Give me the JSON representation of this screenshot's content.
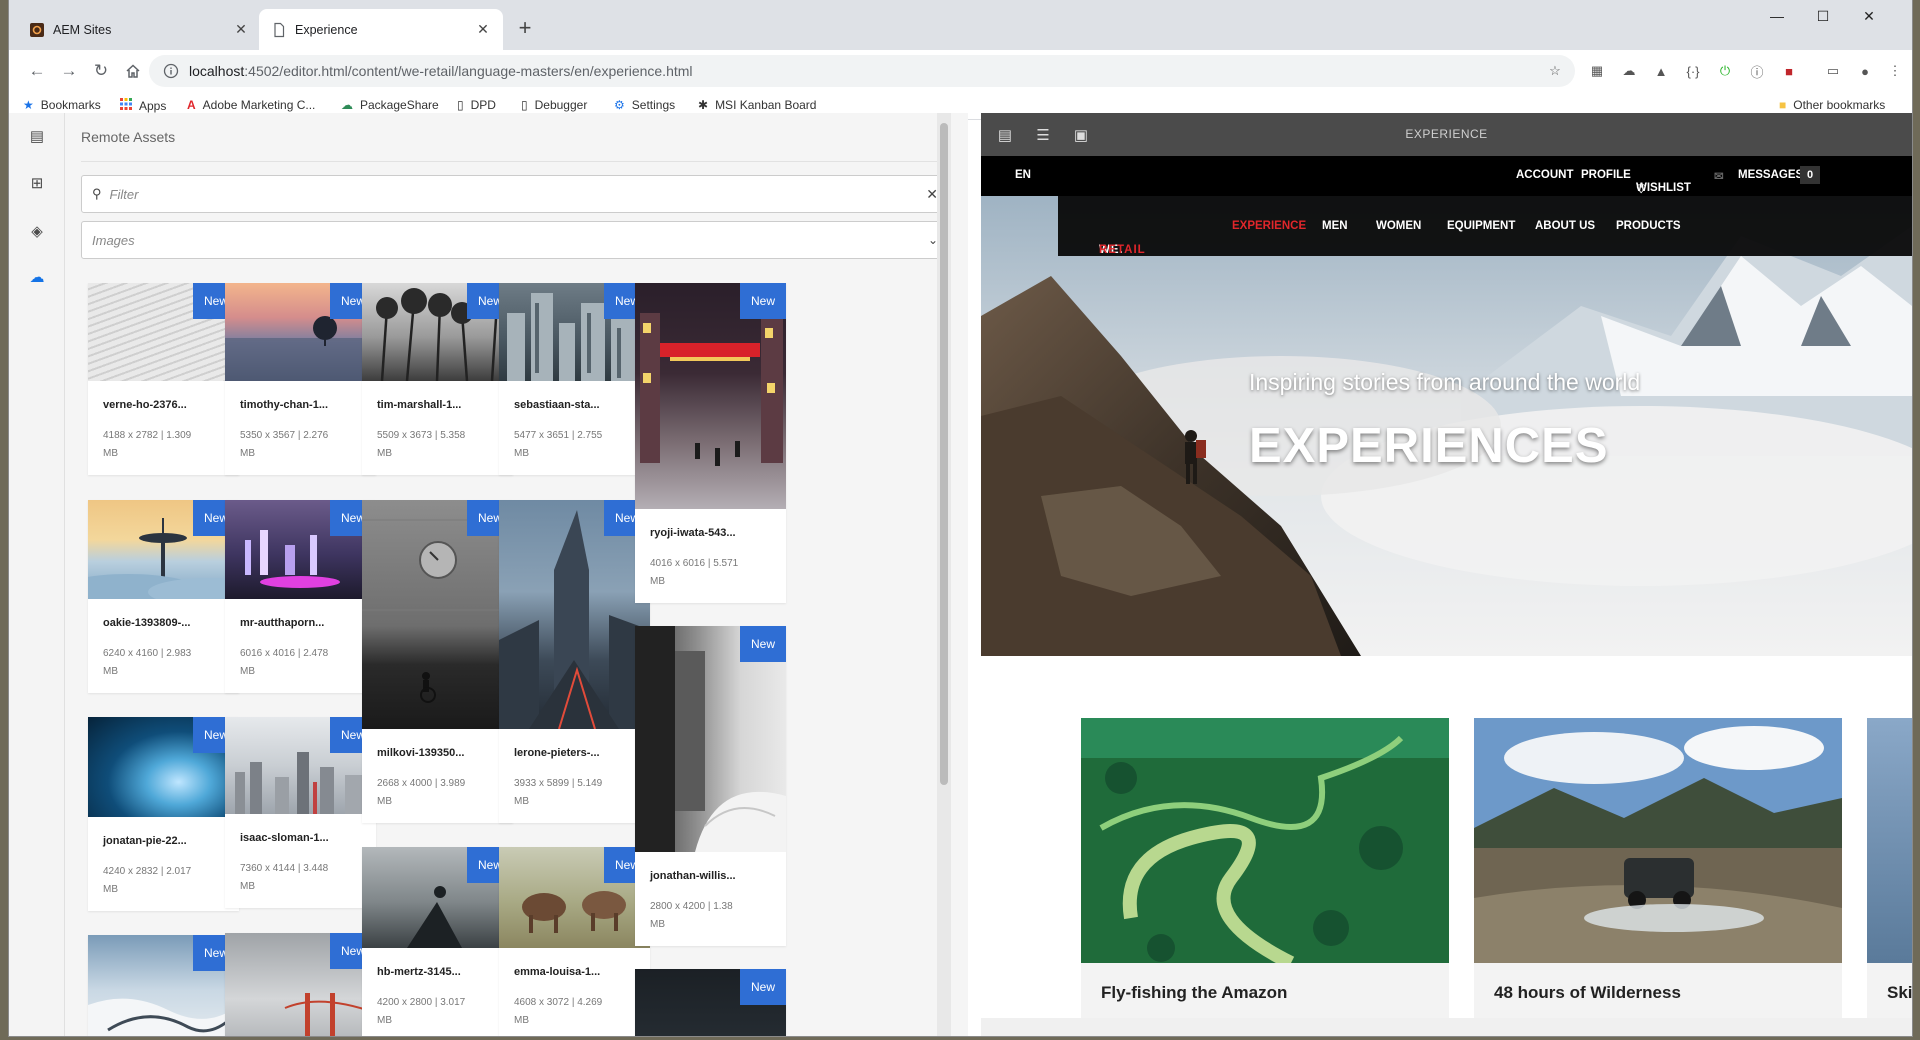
{
  "browser": {
    "tabs": [
      {
        "title": "AEM Sites",
        "close": "✕"
      },
      {
        "title": "Experience",
        "close": "✕"
      }
    ],
    "new_tab": "+",
    "window_controls": {
      "minimize": "—",
      "maximize": "☐",
      "close": "✕"
    },
    "url_host": "localhost",
    "url_path": ":4502/editor.html/content/we-retail/language-masters/en/experience.html",
    "bookmarks": [
      {
        "label": "Bookmarks",
        "icon": "star-icon"
      },
      {
        "label": "Apps",
        "icon": "apps-grid-icon"
      },
      {
        "label": "Adobe Marketing C...",
        "icon": "adobe-icon"
      },
      {
        "label": "PackageShare",
        "icon": "cloud-icon"
      },
      {
        "label": "DPD",
        "icon": "page-icon"
      },
      {
        "label": "Debugger",
        "icon": "page-icon"
      },
      {
        "label": "Settings",
        "icon": "gear-icon"
      },
      {
        "label": "MSI Kanban Board",
        "icon": "kanban-icon"
      }
    ],
    "other_bookmarks": "Other bookmarks"
  },
  "panel": {
    "title": "Remote Assets",
    "filter_placeholder": "Filter",
    "clear": "✕",
    "type_select": "Images"
  },
  "assets": [
    {
      "name": "verne-ho-2376...",
      "dims": "4188 x 2782 | 1.309",
      "unit": "MB",
      "badge": "New"
    },
    {
      "name": "timothy-chan-1...",
      "dims": "5350 x 3567 | 2.276",
      "unit": "MB",
      "badge": "New"
    },
    {
      "name": "tim-marshall-1...",
      "dims": "5509 x 3673 | 5.358",
      "unit": "MB",
      "badge": "New"
    },
    {
      "name": "sebastiaan-sta...",
      "dims": "5477 x 3651 | 2.755",
      "unit": "MB",
      "badge": "New"
    },
    {
      "name": "ryoji-iwata-543...",
      "dims": "4016 x 6016 | 5.571",
      "unit": "MB",
      "badge": "New"
    },
    {
      "name": "oakie-1393809-...",
      "dims": "6240 x 4160 | 2.983",
      "unit": "MB",
      "badge": "New"
    },
    {
      "name": "mr-autthaporn...",
      "dims": "6016 x 4016 | 2.478",
      "unit": "MB",
      "badge": "New"
    },
    {
      "name": "milkovi-139350...",
      "dims": "2668 x 4000 | 3.989",
      "unit": "MB",
      "badge": "New"
    },
    {
      "name": "lerone-pieters-...",
      "dims": "3933 x 5899 | 5.149",
      "unit": "MB",
      "badge": "New"
    },
    {
      "name": "jonathan-willis...",
      "dims": "2800 x 4200 | 1.38",
      "unit": "MB",
      "badge": "New"
    },
    {
      "name": "jonatan-pie-22...",
      "dims": "4240 x 2832 | 2.017",
      "unit": "MB",
      "badge": "New"
    },
    {
      "name": "isaac-sloman-1...",
      "dims": "7360 x 4144 | 3.448",
      "unit": "MB",
      "badge": "New"
    },
    {
      "name": "hb-mertz-3145...",
      "dims": "4200 x 2800 | 3.017",
      "unit": "MB",
      "badge": "New"
    },
    {
      "name": "emma-louisa-1...",
      "dims": "4608 x 3072 | 4.269",
      "unit": "MB",
      "badge": "New"
    },
    {
      "name": "",
      "dims": "",
      "unit": "",
      "badge": "New"
    },
    {
      "name": "",
      "dims": "",
      "unit": "",
      "badge": "New"
    },
    {
      "name": "",
      "dims": "",
      "unit": "",
      "badge": "New"
    }
  ],
  "editor": {
    "title": "EXPERIENCE",
    "topbar": {
      "lang": "EN",
      "account": "ACCOUNT",
      "profile": "PROFILE",
      "wishlist": "WISHLIST",
      "messages": "MESSAGES",
      "messages_count": "0"
    },
    "nav": {
      "logo_a": "WE.",
      "logo_b": "RETAIL",
      "items": [
        "EXPERIENCE",
        "MEN",
        "WOMEN",
        "EQUIPMENT",
        "ABOUT US",
        "PRODUCTS"
      ]
    },
    "hero_sub": "Inspiring stories from around the world",
    "hero_title": "EXPERIENCES",
    "cards": [
      "Fly-fishing the Amazon",
      "48 hours of Wilderness",
      "Ski"
    ]
  },
  "colors": {
    "accent": "#2f6ed4",
    "brand_red": "#e0262b",
    "toolbar": "#4b4b4b"
  }
}
